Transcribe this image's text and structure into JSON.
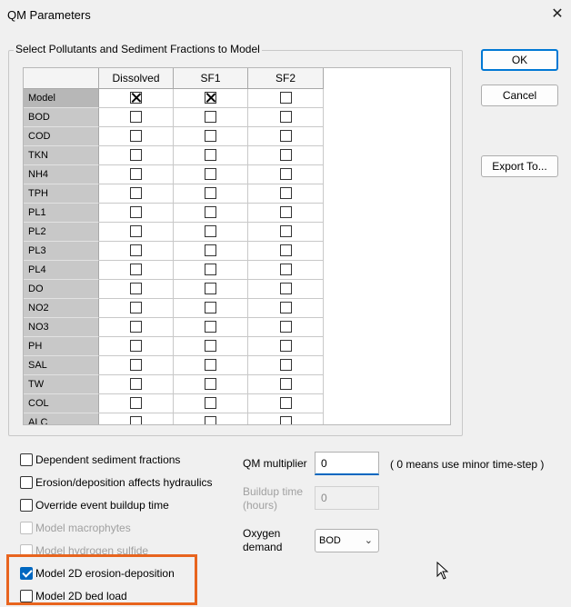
{
  "window": {
    "title": "QM Parameters",
    "close_glyph": "✕"
  },
  "group": {
    "label": "Select Pollutants and Sediment Fractions to Model"
  },
  "grid": {
    "columns": [
      "Dissolved",
      "SF1",
      "SF2"
    ],
    "rows": [
      {
        "name": "Model",
        "checks": [
          true,
          true,
          false
        ]
      },
      {
        "name": "BOD",
        "checks": [
          false,
          false,
          false
        ]
      },
      {
        "name": "COD",
        "checks": [
          false,
          false,
          false
        ]
      },
      {
        "name": "TKN",
        "checks": [
          false,
          false,
          false
        ]
      },
      {
        "name": "NH4",
        "checks": [
          false,
          false,
          false
        ]
      },
      {
        "name": "TPH",
        "checks": [
          false,
          false,
          false
        ]
      },
      {
        "name": "PL1",
        "checks": [
          false,
          false,
          false
        ]
      },
      {
        "name": "PL2",
        "checks": [
          false,
          false,
          false
        ]
      },
      {
        "name": "PL3",
        "checks": [
          false,
          false,
          false
        ]
      },
      {
        "name": "PL4",
        "checks": [
          false,
          false,
          false
        ]
      },
      {
        "name": "DO",
        "checks": [
          false,
          false,
          false
        ]
      },
      {
        "name": "NO2",
        "checks": [
          false,
          false,
          false
        ]
      },
      {
        "name": "NO3",
        "checks": [
          false,
          false,
          false
        ]
      },
      {
        "name": "PH",
        "checks": [
          false,
          false,
          false
        ]
      },
      {
        "name": "SAL",
        "checks": [
          false,
          false,
          false
        ]
      },
      {
        "name": "TW",
        "checks": [
          false,
          false,
          false
        ]
      },
      {
        "name": "COL",
        "checks": [
          false,
          false,
          false
        ]
      },
      {
        "name": "ALC",
        "checks": [
          false,
          false,
          false
        ]
      }
    ]
  },
  "buttons": {
    "ok": "OK",
    "cancel": "Cancel",
    "export": "Export To..."
  },
  "options": [
    {
      "label": "Dependent sediment fractions",
      "checked": false,
      "enabled": true
    },
    {
      "label": "Erosion/deposition affects hydraulics",
      "checked": false,
      "enabled": true
    },
    {
      "label": "Override event buildup time",
      "checked": false,
      "enabled": true
    },
    {
      "label": "Model macrophytes",
      "checked": false,
      "enabled": false
    },
    {
      "label": "Model hydrogen sulfide",
      "checked": false,
      "enabled": false
    },
    {
      "label": "Model 2D erosion-deposition",
      "checked": true,
      "enabled": true
    },
    {
      "label": "Model 2D bed load",
      "checked": false,
      "enabled": true
    }
  ],
  "qm_multiplier": {
    "label": "QM multiplier",
    "value": "0",
    "note": "( 0 means use minor time-step )"
  },
  "buildup_time": {
    "label": "Buildup time (hours)",
    "value": "0"
  },
  "oxygen_demand": {
    "label": "Oxygen demand",
    "value": "BOD"
  },
  "colors": {
    "accent": "#0067c0",
    "highlight": "#e8641e"
  }
}
